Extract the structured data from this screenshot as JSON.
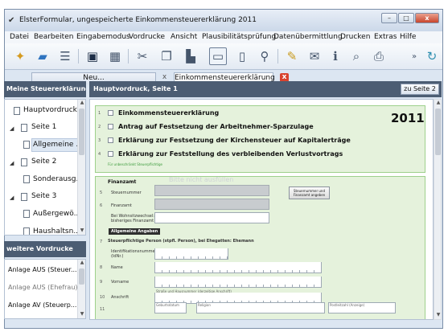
{
  "window": {
    "title": "ElsterFormular, ungespeicherte Einkommensteuererklärung 2011",
    "btn_minimize": "–",
    "btn_maximize": "□",
    "btn_close": "x"
  },
  "menu": [
    "Datei",
    "Bearbeiten",
    "Eingabemodus",
    "Vordrucke",
    "Ansicht",
    "Plausibilitätsprüfung",
    "Datenübermittlung",
    "Drucken",
    "Extras",
    "Hilfe"
  ],
  "toolbar": {
    "overflow_label": "»"
  },
  "tabs": [
    {
      "label": "Neu..."
    },
    {
      "label": "Einkommensteuererklärung 2011"
    }
  ],
  "left_panel": {
    "heading": "Meine Steuererklärung",
    "tree": [
      {
        "label": "Hauptvordruck",
        "expander": ""
      },
      {
        "label": "Seite 1",
        "expander": "◢"
      },
      {
        "label": "Allgemeine ...",
        "expander": ""
      },
      {
        "label": "Seite 2",
        "expander": "◢"
      },
      {
        "label": "Sonderausg...",
        "expander": ""
      },
      {
        "label": "Seite 3",
        "expander": "◢"
      },
      {
        "label": "Außergewö...",
        "expander": ""
      },
      {
        "label": "Haushaltsn...",
        "expander": ""
      }
    ]
  },
  "other_forms": {
    "heading": "weitere Vordrucke",
    "items": [
      "Anlage AUS (Steuer...",
      "Anlage AUS (Ehefrau)",
      "Anlage AV (Steuerp..."
    ]
  },
  "main": {
    "heading": "Hauptvordruck, Seite 1",
    "next_button": "zu Seite 2"
  },
  "form": {
    "row_nums": [
      "1",
      "2",
      "3",
      "4",
      "5",
      "6",
      "7",
      "8",
      "9",
      "10",
      "11"
    ],
    "title_checks": [
      "Einkommensteuererklärung",
      "Antrag auf Festsetzung der Arbeitnehmer-Sparzulage",
      "Erklärung zur Festsetzung der Kirchensteuer auf Kapitalerträge",
      "Erklärung zur Feststellung des verbleibenden Verlustvortrags"
    ],
    "year": "2011",
    "unchangeable_note": "Für unbeschränkt Steuerpflichtige",
    "finanzamt_label": "Finanzamt",
    "steuernummer_label": "Steuernummer",
    "finanzamt_field_label": "Finanzamt",
    "wohnsitzwechsel_label": "Bei Wohnsitzwechsel: bisheriges Finanzamt",
    "faint_text": "Bitte nicht ausfüllen",
    "lookup_button": "Steuernummer und Finanzamt angeben",
    "section_general": "Allgemeine Angaben",
    "person_header": "Steuerpflichtige Person (stpfl. Person), bei Ehegatten: Ehemann",
    "idnr_label": "Identifikationsnummer (IdNr.)",
    "name_label": "Name",
    "vorname_label": "Vorname",
    "anschrift_label": "Anschrift",
    "street_hint": "Straße und Hausnummer (derzeitige Anschrift)",
    "birth_hint": "Geburtsdatum",
    "religion_hint": "Religion",
    "plz_hint": "Postleitzahl (Anzeige)"
  }
}
